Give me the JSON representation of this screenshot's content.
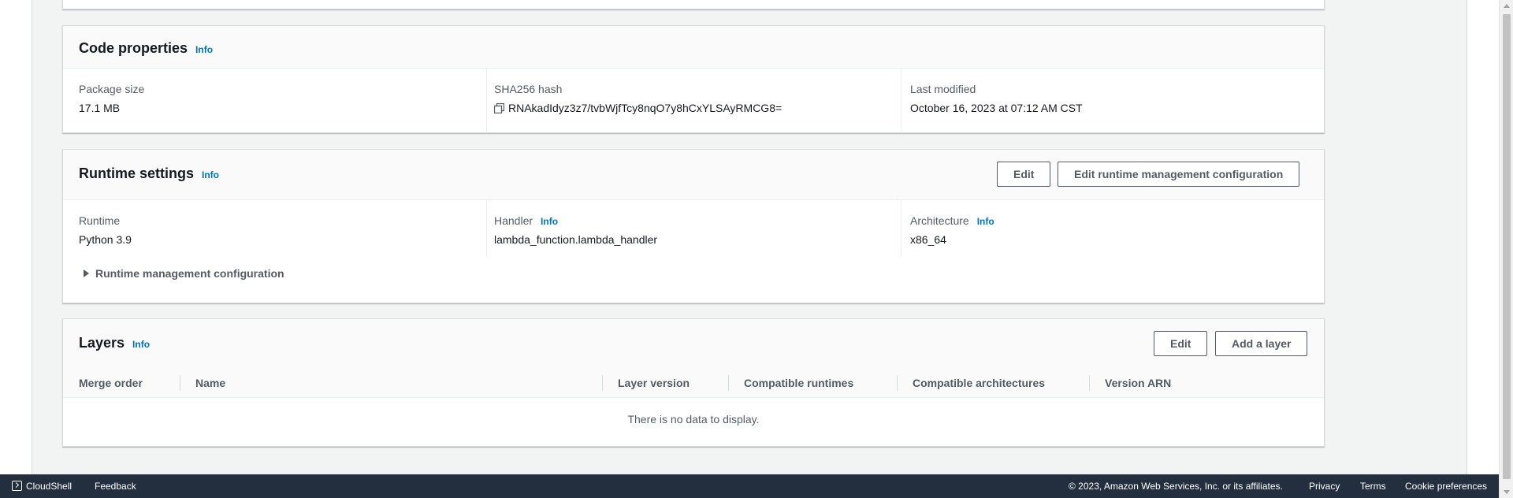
{
  "code_properties": {
    "title": "Code properties",
    "info": "Info",
    "package_size_label": "Package size",
    "package_size_value": "17.1 MB",
    "sha_label": "SHA256 hash",
    "sha_value": "RNAkadIdyz3z7/tvbWjfTcy8nqO7y8hCxYLSAyRMCG8=",
    "last_modified_label": "Last modified",
    "last_modified_value": "October 16, 2023 at 07:12 AM CST"
  },
  "runtime_settings": {
    "title": "Runtime settings",
    "info": "Info",
    "edit_button": "Edit",
    "edit_runtime_mgmt_button": "Edit runtime management configuration",
    "runtime_label": "Runtime",
    "runtime_value": "Python 3.9",
    "handler_label": "Handler",
    "handler_info": "Info",
    "handler_value": "lambda_function.lambda_handler",
    "architecture_label": "Architecture",
    "architecture_info": "Info",
    "architecture_value": "x86_64",
    "expander_label": "Runtime management configuration"
  },
  "layers": {
    "title": "Layers",
    "info": "Info",
    "edit_button": "Edit",
    "add_button": "Add a layer",
    "columns": [
      "Merge order",
      "Name",
      "Layer version",
      "Compatible runtimes",
      "Compatible architectures",
      "Version ARN"
    ],
    "empty_message": "There is no data to display."
  },
  "footer": {
    "cloudshell": "CloudShell",
    "feedback": "Feedback",
    "copyright": "© 2023, Amazon Web Services, Inc. or its affiliates.",
    "privacy": "Privacy",
    "terms": "Terms",
    "cookie_preferences": "Cookie preferences"
  },
  "colors": {
    "link": "#0073bb",
    "footer_bg": "#232f3e",
    "page_bg": "#f2f3f3"
  }
}
